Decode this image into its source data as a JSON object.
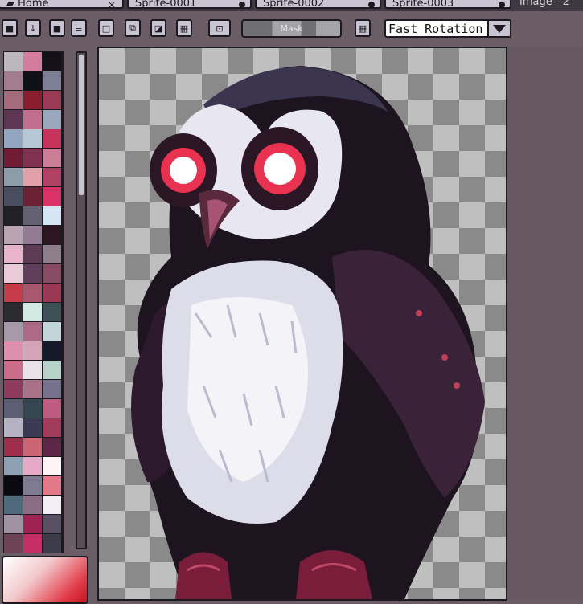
{
  "tabs": [
    {
      "label": "Home",
      "close": "×"
    },
    {
      "label": "Sprite-0001"
    },
    {
      "label": "Sprite-0002"
    },
    {
      "label": "Sprite-0003"
    }
  ],
  "image_title": "Image - 2",
  "toolbar": {
    "mask_label": "Mask",
    "rotation_value": "Fast Rotation"
  },
  "palette_colors": [
    "#bdb7bd",
    "#d27d9d",
    "#14101a",
    "#a37c8f",
    "#0f1116",
    "#7c7f96",
    "#a56a7c",
    "#8b1b2f",
    "#9a3c55",
    "#5d3654",
    "#c16f8d",
    "#99a8bd",
    "#93a6c1",
    "#b5c7d4",
    "#c9325a",
    "#721b34",
    "#833151",
    "#cc7e98",
    "#8d9cab",
    "#e2a0ab",
    "#b04164",
    "#4a4d5f",
    "#6c2233",
    "#d93369",
    "#202026",
    "#636071",
    "#d4e5f3",
    "#b9a3b3",
    "#927b92",
    "#2c1622",
    "#e8b3cb",
    "#5b3c54",
    "#8f7e8c",
    "#e9cad6",
    "#613f5b",
    "#884b64",
    "#c63b49",
    "#a9576f",
    "#9b3854",
    "#2a2c30",
    "#d0e9e1",
    "#3e5157",
    "#a79aa8",
    "#ad6a86",
    "#c2d6d9",
    "#dd8fac",
    "#d6a4b8",
    "#15192b",
    "#ca6c8a",
    "#eae1e7",
    "#b6d2c9",
    "#8f3b5f",
    "#a97286",
    "#76718d",
    "#5d5d73",
    "#364651",
    "#bd5b80",
    "#b5b3c3",
    "#3a3a54",
    "#a23a5a",
    "#9e2e4b",
    "#cc6474",
    "#5d2848",
    "#8da1b2",
    "#e6aac8",
    "#fff4f5",
    "#0b0a12",
    "#7e7b91",
    "#e57888",
    "#4e6a7b",
    "#8a6c84",
    "#f2eef2",
    "#9f92a3",
    "#a02255",
    "#575263",
    "#6f4356",
    "#c62e64",
    "#3c3c4a"
  ]
}
